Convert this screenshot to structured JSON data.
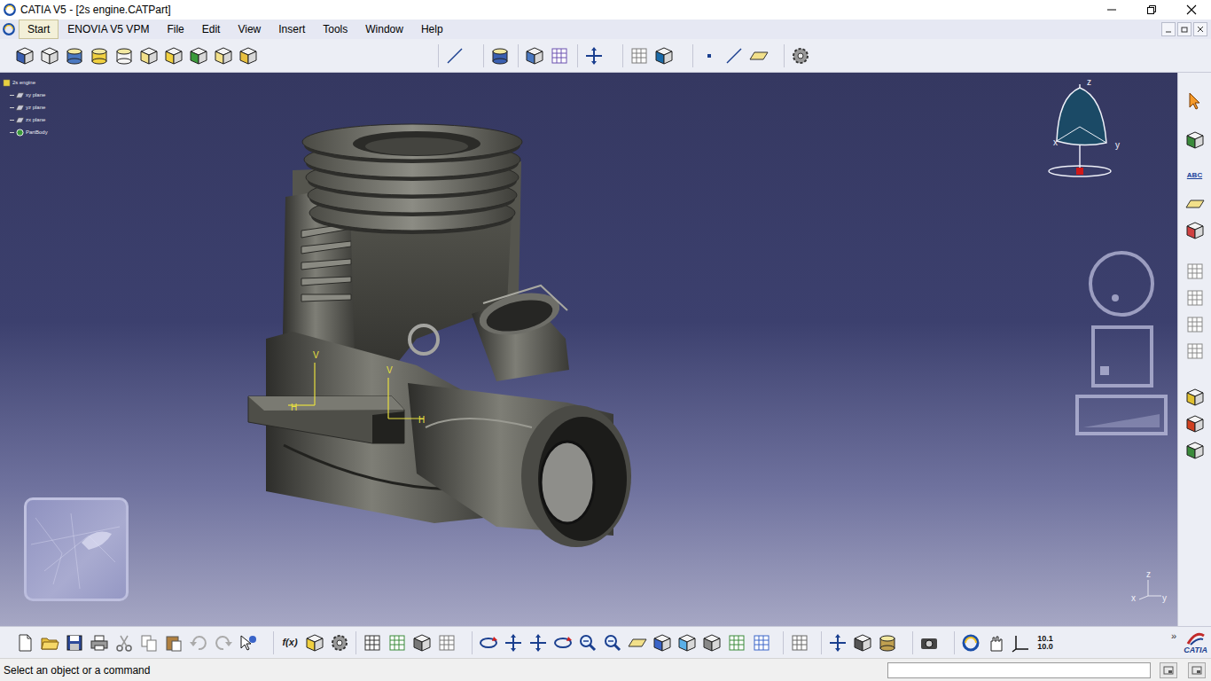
{
  "window": {
    "title": "CATIA V5 - [2s engine.CATPart]"
  },
  "menu": [
    {
      "label": "Start",
      "selected": true
    },
    {
      "label": "ENOVIA V5 VPM",
      "selected": false
    },
    {
      "label": "File",
      "selected": false
    },
    {
      "label": "Edit",
      "selected": false
    },
    {
      "label": "View",
      "selected": false
    },
    {
      "label": "Insert",
      "selected": false
    },
    {
      "label": "Tools",
      "selected": false
    },
    {
      "label": "Window",
      "selected": false
    },
    {
      "label": "Help",
      "selected": false
    }
  ],
  "tree": [
    {
      "label": "2s engine",
      "kind": "root"
    },
    {
      "label": "xy plane",
      "kind": "plane"
    },
    {
      "label": "yz plane",
      "kind": "plane"
    },
    {
      "label": "zx plane",
      "kind": "plane"
    },
    {
      "label": "PartBody",
      "kind": "body"
    }
  ],
  "sketch_axes": [
    {
      "v": "V",
      "h": "H"
    },
    {
      "v": "V",
      "h": "H"
    }
  ],
  "compass": {
    "z": "z",
    "x": "x",
    "y": "y"
  },
  "axis_triad": {
    "z": "z",
    "x": "x",
    "y": "y"
  },
  "toolbar_texts": {
    "formula": "f(x)",
    "units_top": "10.1",
    "units_bottom": "10.0",
    "text_tool": "ABC",
    "overflow": "»"
  },
  "logo": {
    "brand": "CATIA"
  },
  "status_bar": {
    "message": "Select an object or a command",
    "input": ""
  }
}
